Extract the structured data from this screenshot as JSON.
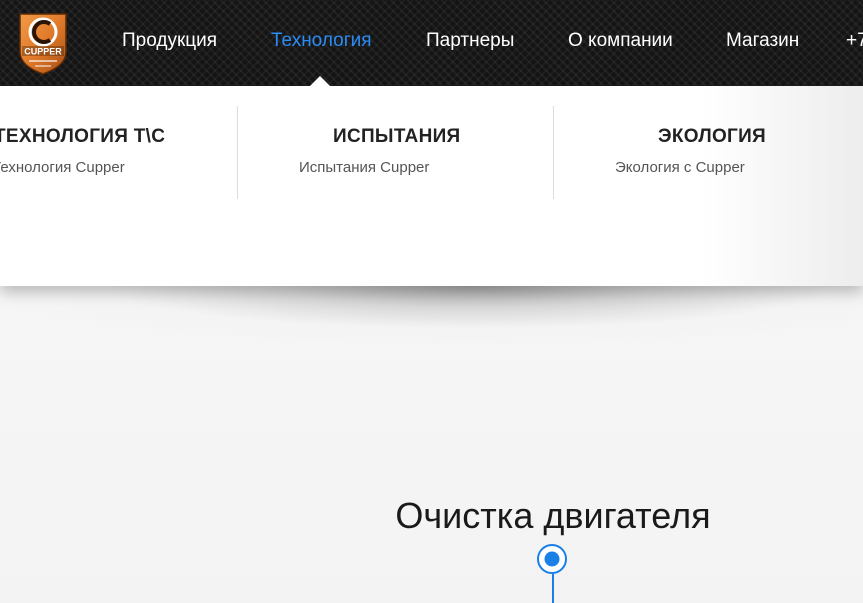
{
  "header": {
    "logo_text": "CUPPER",
    "nav": [
      {
        "label": "Продукция",
        "active": false
      },
      {
        "label": "Технология",
        "active": true
      },
      {
        "label": "Партнеры",
        "active": false
      },
      {
        "label": "О компании",
        "active": false
      },
      {
        "label": "Магазин",
        "active": false
      },
      {
        "label": "+7",
        "active": false
      }
    ]
  },
  "dropdown": {
    "columns": [
      {
        "title": "ТЕХНОЛОГИЯ Т\\С",
        "link": "Технология Cupper"
      },
      {
        "title": "ИСПЫТАНИЯ",
        "link": "Испытания Cupper"
      },
      {
        "title": "ЭКОЛОГИЯ",
        "link": "Экология с Cupper"
      }
    ]
  },
  "main": {
    "section_title": "Очистка двигателя"
  },
  "colors": {
    "accent": "#2a8cf4",
    "navbar_bg": "#141414",
    "logo_orange": "#e07a2a",
    "timeline_blue": "#1a7fe6"
  }
}
